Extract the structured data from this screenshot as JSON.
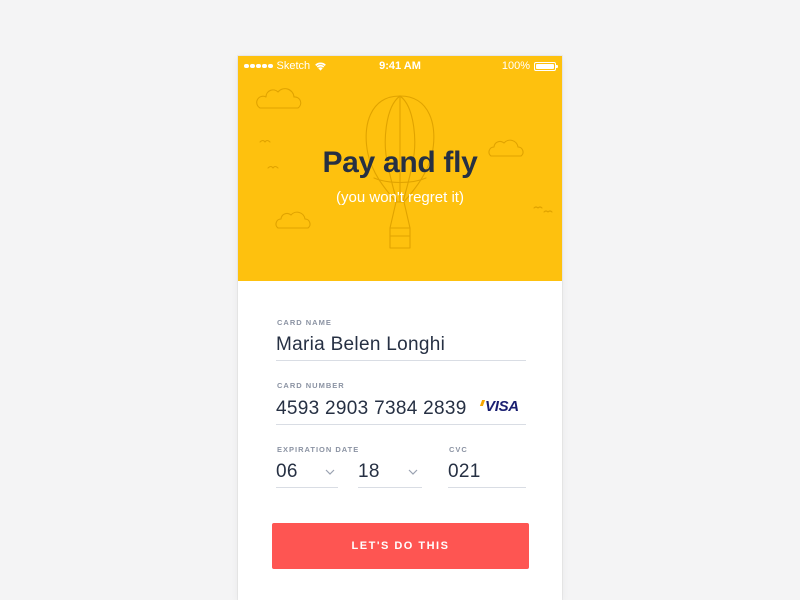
{
  "status_bar": {
    "carrier": "Sketch",
    "time": "9:41 AM",
    "battery": "100%"
  },
  "hero": {
    "title": "Pay and fly",
    "subtitle": "(you won't regret it)",
    "background_color": "#fec10e",
    "illustration": "hot-air-balloon-with-clouds-and-birds"
  },
  "form": {
    "card_name": {
      "label": "CARD NAME",
      "value": "Maria Belen Longhi"
    },
    "card_number": {
      "label": "CARD NUMBER",
      "value": "4593 2903 7384 2839",
      "brand": "VISA"
    },
    "expiration": {
      "label": "EXPIRATION DATE",
      "month": "06",
      "year": "18"
    },
    "cvc": {
      "label": "CVC",
      "value": "021"
    }
  },
  "cta": {
    "label": "LET'S DO THIS",
    "color": "#fe5552"
  }
}
